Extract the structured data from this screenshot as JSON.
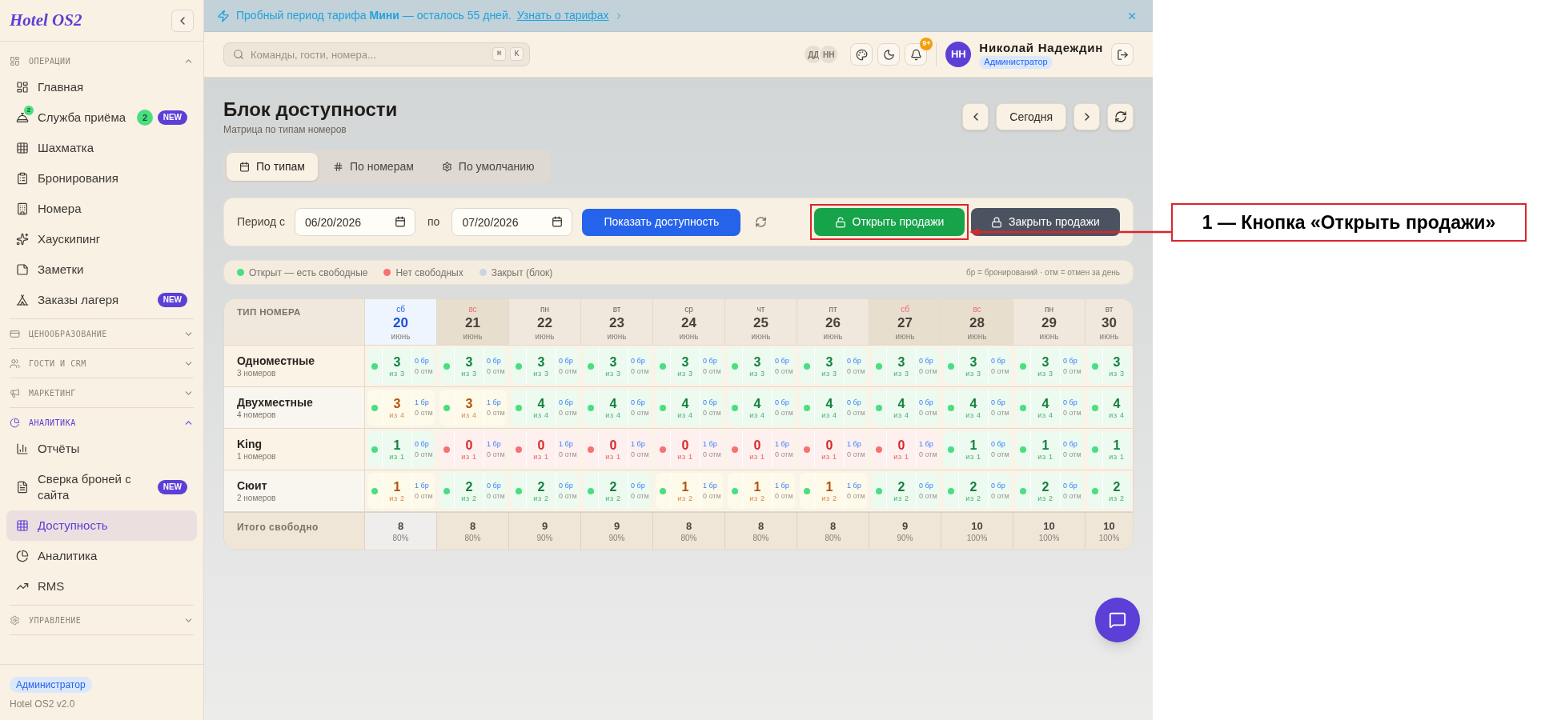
{
  "sidebar": {
    "logo": "Hotel OS2",
    "sections": [
      {
        "title": "ОПЕРАЦИИ",
        "expanded": true,
        "items": [
          {
            "label": "Главная",
            "selected": false
          },
          {
            "label": "Служба приёма",
            "selected": false,
            "icon_badge": "2",
            "count": "2",
            "badge": "NEW"
          },
          {
            "label": "Шахматка",
            "selected": false
          },
          {
            "label": "Бронирования",
            "selected": false
          },
          {
            "label": "Номера",
            "selected": false
          },
          {
            "label": "Хаускипинг",
            "selected": false
          },
          {
            "label": "Заметки",
            "selected": false
          },
          {
            "label": "Заказы лагеря",
            "selected": false,
            "badge": "NEW"
          }
        ]
      },
      {
        "title": "ЦЕНООБРАЗОВАНИЕ",
        "expanded": false
      },
      {
        "title": "ГОСТИ И CRM",
        "expanded": false
      },
      {
        "title": "МАРКЕТИНГ",
        "expanded": false
      },
      {
        "title": "АНАЛИТИКА",
        "expanded": true,
        "items": [
          {
            "label": "Отчёты",
            "selected": false
          },
          {
            "label": "Сверка броней с сайта",
            "selected": false,
            "badge": "NEW"
          },
          {
            "label": "Доступность",
            "selected": true
          },
          {
            "label": "Аналитика",
            "selected": false
          },
          {
            "label": "RMS",
            "selected": false
          }
        ]
      },
      {
        "title": "УПРАВЛЕНИЕ",
        "expanded": false
      }
    ],
    "footer": {
      "role": "Администратор",
      "version": "Hotel OS2 v2.0"
    }
  },
  "banner": {
    "text": "Пробный период тарифа **Мини** — осталось 55 дней.",
    "link": "Узнать о тарифах"
  },
  "header": {
    "search": {
      "placeholder": "Команды, гости, номера...",
      "keys": [
        "⌘",
        "K"
      ]
    },
    "presence": [
      "ДД",
      "НН"
    ],
    "notifications_badge": "9+",
    "user": {
      "initials": "НН",
      "name": "Николай Надеждин",
      "role": "Администратор"
    }
  },
  "page": {
    "title": "Блок доступности",
    "subtitle": "Матрица по типам номеров",
    "today_button": "Сегодня"
  },
  "view_tabs": [
    {
      "label": "По типам",
      "selected": true
    },
    {
      "label": "По номерам",
      "selected": false
    },
    {
      "label": "По умолчанию",
      "selected": false
    }
  ],
  "filters": {
    "from_label": "Период с",
    "date_from": "06/20/2026",
    "to_label": "по",
    "date_to": "07/20/2026",
    "show_button": "Показать доступность",
    "open_button": "Открыть продажи",
    "close_button": "Закрыть продажи"
  },
  "legend": {
    "items": [
      {
        "label": "Открыт — есть свободные",
        "color": "#4ade80"
      },
      {
        "label": "Нет свободных",
        "color": "#f87171"
      },
      {
        "label": "Закрыт (блок)",
        "color": "#cbd5e1"
      }
    ],
    "note": "бр = бронирований · отм = отмен за день"
  },
  "table": {
    "corner": "ТИП НОМЕРА",
    "columns": [
      {
        "weekday": "сб",
        "day": "20",
        "month": "июнь",
        "today": true
      },
      {
        "weekday": "вс",
        "day": "21",
        "month": "июнь",
        "today": false,
        "weekend": true
      },
      {
        "weekday": "пн",
        "day": "22",
        "month": "июнь",
        "today": false,
        "weekend": false
      },
      {
        "weekday": "вт",
        "day": "23",
        "month": "июнь",
        "today": false,
        "weekend": false
      },
      {
        "weekday": "ср",
        "day": "24",
        "month": "июнь",
        "today": false,
        "weekend": false
      },
      {
        "weekday": "чт",
        "day": "25",
        "month": "июнь",
        "today": false,
        "weekend": false
      },
      {
        "weekday": "пт",
        "day": "26",
        "month": "июнь",
        "today": false,
        "weekend": false
      },
      {
        "weekday": "сб",
        "day": "27",
        "month": "июнь",
        "today": false,
        "weekend": true
      },
      {
        "weekday": "вс",
        "day": "28",
        "month": "июнь",
        "today": false,
        "weekend": true
      },
      {
        "weekday": "пн",
        "day": "29",
        "month": "июнь",
        "today": false,
        "weekend": false
      },
      {
        "weekday": "вт",
        "day": "30",
        "month": "июнь",
        "today": false,
        "weekend": false
      }
    ],
    "rows": [
      {
        "name": "Одноместные",
        "count": "3 номеров",
        "cells": [
          {
            "kind": "free",
            "free": "3",
            "of": "из 3",
            "booked": "0 бр",
            "cancelled": "0 отм"
          },
          {
            "kind": "free",
            "free": "3",
            "of": "из 3",
            "booked": "0 бр",
            "cancelled": "0 отм"
          },
          {
            "kind": "free",
            "free": "3",
            "of": "из 3",
            "booked": "0 бр",
            "cancelled": "0 отм"
          },
          {
            "kind": "free",
            "free": "3",
            "of": "из 3",
            "booked": "0 бр",
            "cancelled": "0 отм"
          },
          {
            "kind": "free",
            "free": "3",
            "of": "из 3",
            "booked": "0 бр",
            "cancelled": "0 отм"
          },
          {
            "kind": "free",
            "free": "3",
            "of": "из 3",
            "booked": "0 бр",
            "cancelled": "0 отм"
          },
          {
            "kind": "free",
            "free": "3",
            "of": "из 3",
            "booked": "0 бр",
            "cancelled": "0 отм"
          },
          {
            "kind": "free",
            "free": "3",
            "of": "из 3",
            "booked": "0 бр",
            "cancelled": "0 отм"
          },
          {
            "kind": "free",
            "free": "3",
            "of": "из 3",
            "booked": "0 бр",
            "cancelled": "0 отм"
          },
          {
            "kind": "free",
            "free": "3",
            "of": "из 3",
            "booked": "0 бр",
            "cancelled": "0 отм"
          },
          {
            "kind": "free",
            "free": "3",
            "of": "из 3"
          }
        ]
      },
      {
        "name": "Двухместные",
        "count": "4 номеров",
        "cells": [
          {
            "kind": "partial",
            "free": "3",
            "of": "из 4",
            "booked": "1 бр",
            "cancelled": "0 отм"
          },
          {
            "kind": "partial",
            "free": "3",
            "of": "из 4",
            "booked": "1 бр",
            "cancelled": "0 отм"
          },
          {
            "kind": "free",
            "free": "4",
            "of": "из 4",
            "booked": "0 бр",
            "cancelled": "0 отм"
          },
          {
            "kind": "free",
            "free": "4",
            "of": "из 4",
            "booked": "0 бр",
            "cancelled": "0 отм"
          },
          {
            "kind": "free",
            "free": "4",
            "of": "из 4",
            "booked": "0 бр",
            "cancelled": "0 отм"
          },
          {
            "kind": "free",
            "free": "4",
            "of": "из 4",
            "booked": "0 бр",
            "cancelled": "0 отм"
          },
          {
            "kind": "free",
            "free": "4",
            "of": "из 4",
            "booked": "0 бр",
            "cancelled": "0 отм"
          },
          {
            "kind": "free",
            "free": "4",
            "of": "из 4",
            "booked": "0 бр",
            "cancelled": "0 отм"
          },
          {
            "kind": "free",
            "free": "4",
            "of": "из 4",
            "booked": "0 бр",
            "cancelled": "0 отм"
          },
          {
            "kind": "free",
            "free": "4",
            "of": "из 4",
            "booked": "0 бр",
            "cancelled": "0 отм"
          },
          {
            "kind": "free",
            "free": "4",
            "of": "из 4"
          }
        ]
      },
      {
        "name": "King",
        "count": "1 номеров",
        "cells": [
          {
            "kind": "free",
            "free": "1",
            "of": "из 1",
            "booked": "0 бр",
            "cancelled": "0 отм"
          },
          {
            "kind": "none",
            "free": "0",
            "of": "из 1",
            "booked": "1 бр",
            "cancelled": "0 отм"
          },
          {
            "kind": "none",
            "free": "0",
            "of": "из 1",
            "booked": "1 бр",
            "cancelled": "0 отм"
          },
          {
            "kind": "none",
            "free": "0",
            "of": "из 1",
            "booked": "1 бр",
            "cancelled": "0 отм"
          },
          {
            "kind": "none",
            "free": "0",
            "of": "из 1",
            "booked": "1 бр",
            "cancelled": "0 отм"
          },
          {
            "kind": "none",
            "free": "0",
            "of": "из 1",
            "booked": "1 бр",
            "cancelled": "0 отм"
          },
          {
            "kind": "none",
            "free": "0",
            "of": "из 1",
            "booked": "1 бр",
            "cancelled": "0 отм"
          },
          {
            "kind": "none",
            "free": "0",
            "of": "из 1",
            "booked": "1 бр",
            "cancelled": "0 отм"
          },
          {
            "kind": "free",
            "free": "1",
            "of": "из 1",
            "booked": "0 бр",
            "cancelled": "0 отм"
          },
          {
            "kind": "free",
            "free": "1",
            "of": "из 1",
            "booked": "0 бр",
            "cancelled": "0 отм"
          },
          {
            "kind": "free",
            "free": "1",
            "of": "из 1"
          }
        ]
      },
      {
        "name": "Сюит",
        "count": "2 номеров",
        "cells": [
          {
            "kind": "partial",
            "free": "1",
            "of": "из 2",
            "booked": "1 бр",
            "cancelled": "0 отм"
          },
          {
            "kind": "free",
            "free": "2",
            "of": "из 2",
            "booked": "0 бр",
            "cancelled": "0 отм"
          },
          {
            "kind": "free",
            "free": "2",
            "of": "из 2",
            "booked": "0 бр",
            "cancelled": "0 отм"
          },
          {
            "kind": "free",
            "free": "2",
            "of": "из 2",
            "booked": "0 бр",
            "cancelled": "0 отм"
          },
          {
            "kind": "partial",
            "free": "1",
            "of": "из 2",
            "booked": "1 бр",
            "cancelled": "0 отм"
          },
          {
            "kind": "partial",
            "free": "1",
            "of": "из 2",
            "booked": "1 бр",
            "cancelled": "0 отм"
          },
          {
            "kind": "partial",
            "free": "1",
            "of": "из 2",
            "booked": "1 бр",
            "cancelled": "0 отм"
          },
          {
            "kind": "free",
            "free": "2",
            "of": "из 2",
            "booked": "0 бр",
            "cancelled": "0 отм"
          },
          {
            "kind": "free",
            "free": "2",
            "of": "из 2",
            "booked": "0 бр",
            "cancelled": "0 отм"
          },
          {
            "kind": "free",
            "free": "2",
            "of": "из 2",
            "booked": "0 бр",
            "cancelled": "0 отм"
          },
          {
            "kind": "free",
            "free": "2",
            "of": "из 2"
          }
        ]
      }
    ],
    "totals": {
      "label": "Итого свободно",
      "cells": [
        {
          "value": "8",
          "percent": "80%"
        },
        {
          "value": "8",
          "percent": "80%"
        },
        {
          "value": "9",
          "percent": "90%"
        },
        {
          "value": "9",
          "percent": "90%"
        },
        {
          "value": "8",
          "percent": "80%"
        },
        {
          "value": "8",
          "percent": "80%"
        },
        {
          "value": "8",
          "percent": "80%"
        },
        {
          "value": "9",
          "percent": "90%"
        },
        {
          "value": "10",
          "percent": "100%"
        },
        {
          "value": "10",
          "percent": "100%"
        },
        {
          "value": "10",
          "percent": "100%"
        }
      ]
    }
  },
  "annotation": {
    "label": "1 — Кнопка «Открыть продажи»"
  }
}
